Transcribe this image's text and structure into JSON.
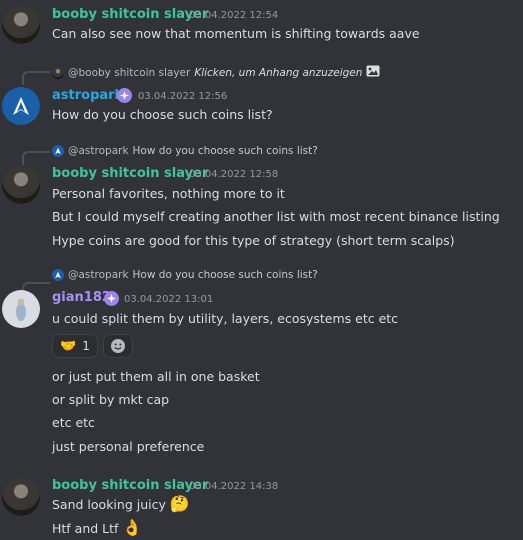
{
  "messages": [
    {
      "author": "booby shitcoin slayer",
      "timestamp": "03.04.2022 12:54",
      "lines": [
        "Can also see now that momentum is shifting towards aave"
      ]
    },
    {
      "reply": {
        "mention": "@booby shitcoin slayer",
        "text": "Klicken, um Anhang anzuzeigen"
      },
      "author": "astropark",
      "timestamp": "03.04.2022 12:56",
      "lines": [
        "How do you choose such coins list?"
      ]
    },
    {
      "reply": {
        "mention": "@astropark",
        "text": "How do you choose such coins list?"
      },
      "author": "booby shitcoin slayer",
      "timestamp": "03.04.2022 12:58",
      "lines": [
        "Personal favorites, nothing more to it",
        "But I could myself creating another list with most recent binance listing",
        "Hype coins are good for this type of strategy (short term scalps)"
      ]
    },
    {
      "reply": {
        "mention": "@astropark",
        "text": "How do you choose such coins list?"
      },
      "author": "gian182",
      "timestamp": "03.04.2022 13:01",
      "lines": [
        "u could split them by utility, layers, ecosystems etc etc",
        "or just put them all in one basket",
        "or split by mkt cap",
        "etc etc",
        "just personal preference"
      ],
      "reaction": {
        "emoji": "🤝",
        "count": "1"
      }
    },
    {
      "author": "booby shitcoin slayer",
      "timestamp": "03.04.2022 14:38",
      "lines": [
        "Sand looking juicy",
        "Htf and Ltf"
      ],
      "emojis": [
        "🤔",
        "👌"
      ]
    }
  ],
  "colors": {
    "background": "#313338",
    "booby": "#3fc59b",
    "astropark": "#27a8e0",
    "gian182": "#a891f5"
  },
  "icons": {
    "image_attachment": "image-icon",
    "add_reaction": "add-reaction-icon",
    "nitro_badge": "nitro-badge-icon"
  }
}
